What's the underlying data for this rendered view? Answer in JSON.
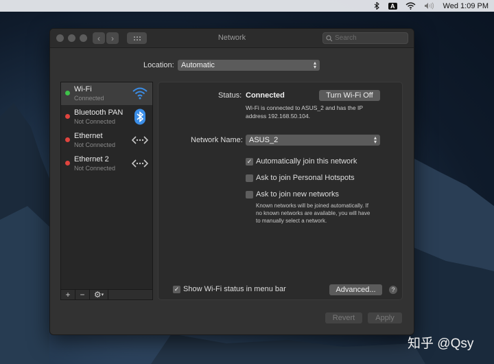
{
  "menubar": {
    "keyboard_letter": "A",
    "clock": "Wed 1:09 PM",
    "icons": [
      "bluetooth-icon",
      "keyboard-input-icon",
      "wifi-icon",
      "volume-icon"
    ]
  },
  "window": {
    "title": "Network",
    "search_placeholder": "Search",
    "back_glyph": "‹",
    "forward_glyph": "›",
    "grid_glyph": "⠿"
  },
  "location": {
    "label": "Location:",
    "value": "Automatic"
  },
  "services": [
    {
      "name": "Wi-Fi",
      "status": "Connected",
      "dot_color": "#3fc24a",
      "icon": "wifi-icon"
    },
    {
      "name": "Bluetooth PAN",
      "status": "Not Connected",
      "dot_color": "#e0443e",
      "icon": "bluetooth-icon"
    },
    {
      "name": "Ethernet",
      "status": "Not Connected",
      "dot_color": "#e0443e",
      "icon": "ethernet-icon"
    },
    {
      "name": "Ethernet 2",
      "status": "Not Connected",
      "dot_color": "#e0443e",
      "icon": "ethernet-icon"
    }
  ],
  "sidebar_tools": {
    "add": "+",
    "remove": "−",
    "action": "⚙"
  },
  "detail": {
    "status_label": "Status:",
    "status_value": "Connected",
    "turn_off_button": "Turn Wi-Fi Off",
    "status_description_line1": "Wi-Fi is connected to ASUS_2 and has the IP",
    "status_description_line2": "address 192.168.50.104.",
    "network_name_label": "Network Name:",
    "network_name_value": "ASUS_2",
    "auto_join_label": "Automatically join this network",
    "auto_join_checked": true,
    "hotspots_label": "Ask to join Personal Hotspots",
    "hotspots_checked": false,
    "new_networks_label": "Ask to join new networks",
    "new_networks_checked": false,
    "note_line1": "Known networks will be joined automatically. If",
    "note_line2": "no known networks are available, you will have",
    "note_line3": "to manually select a network.",
    "show_status_label": "Show Wi-Fi status in menu bar",
    "show_status_checked": true,
    "advanced_button": "Advanced...",
    "help_glyph": "?"
  },
  "footer": {
    "revert_button": "Revert",
    "apply_button": "Apply"
  },
  "watermark": "知乎 @Qsy"
}
